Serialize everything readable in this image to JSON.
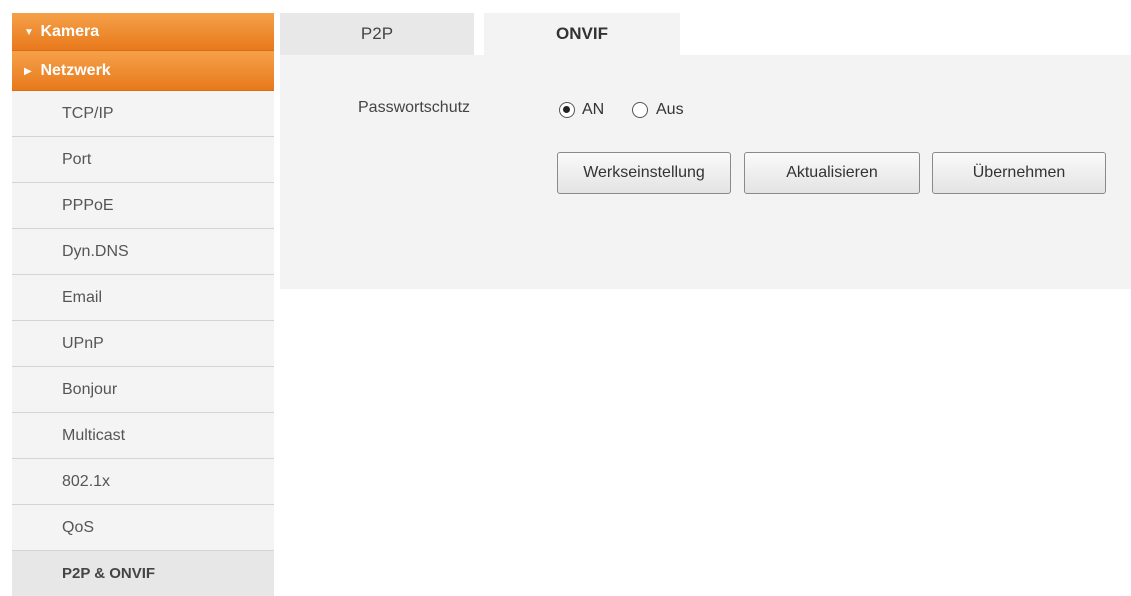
{
  "sidebar": {
    "section_camera": {
      "label": "Kamera",
      "icon": "caret-down-icon"
    },
    "section_network": {
      "label": "Netzwerk",
      "icon": "caret-right-icon"
    },
    "items": [
      {
        "label": "TCP/IP"
      },
      {
        "label": "Port"
      },
      {
        "label": "PPPoE"
      },
      {
        "label": "Dyn.DNS"
      },
      {
        "label": "Email"
      },
      {
        "label": "UPnP"
      },
      {
        "label": "Bonjour"
      },
      {
        "label": "Multicast"
      },
      {
        "label": "802.1x"
      },
      {
        "label": "QoS"
      },
      {
        "label": "P2P & ONVIF",
        "active": true
      }
    ]
  },
  "tabs": [
    {
      "label": "P2P",
      "active": false
    },
    {
      "label": "ONVIF",
      "active": true
    }
  ],
  "form": {
    "password_label": "Passwortschutz",
    "option_on": "AN",
    "option_off": "Aus",
    "selected": "AN"
  },
  "buttons": {
    "factory": "Werkseinstellung",
    "refresh": "Aktualisieren",
    "apply": "Übernehmen"
  },
  "colors": {
    "accent_orange": "#e8791b",
    "panel_bg": "#f3f3f3"
  }
}
